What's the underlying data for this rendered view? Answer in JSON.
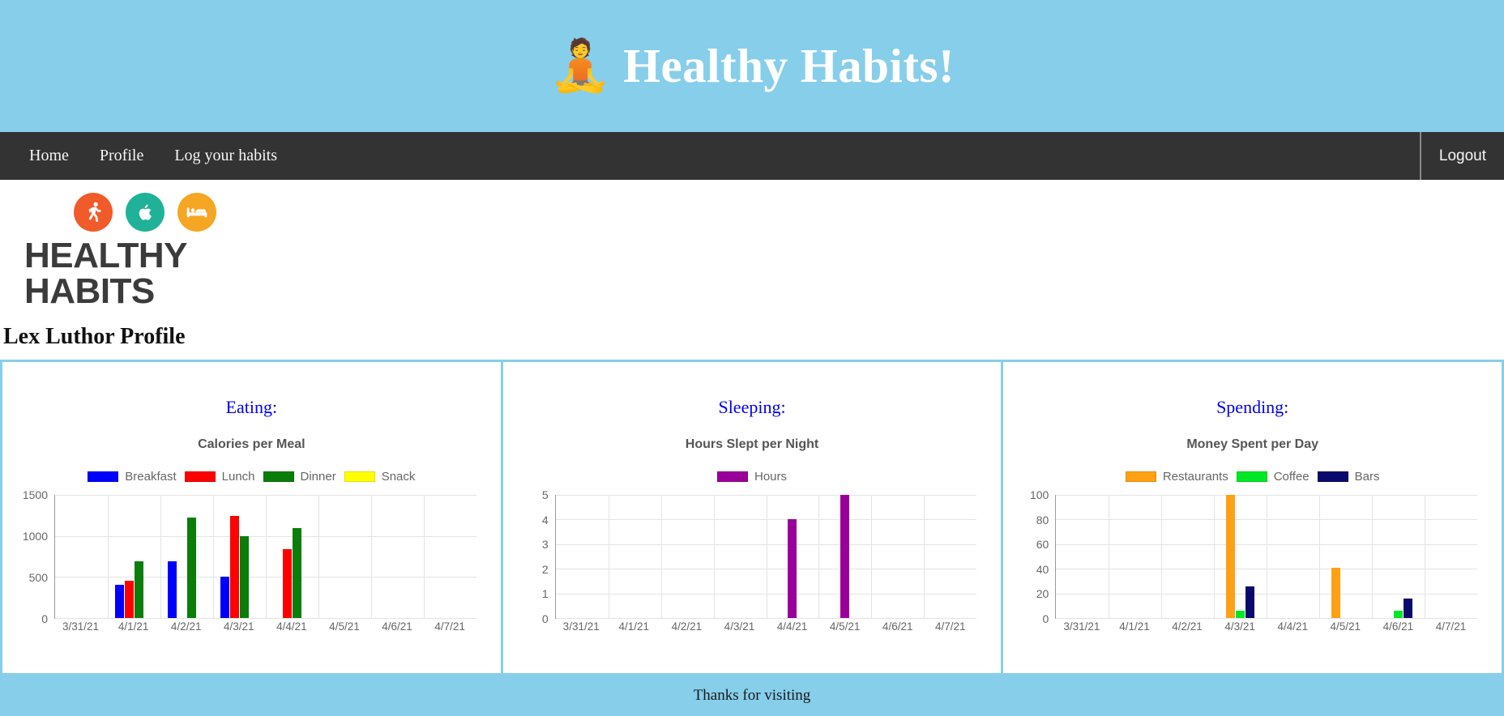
{
  "header": {
    "emoji_icon": "person-in-lotus-position-icon",
    "emoji": "🧘",
    "title": "Healthy Habits!",
    "background_color": "#87CEEB"
  },
  "navbar": {
    "background_color": "#333333",
    "links": [
      {
        "label": "Home"
      },
      {
        "label": "Profile"
      },
      {
        "label": "Log your habits"
      }
    ],
    "logout_label": "Logout"
  },
  "brand": {
    "word": "HEALTHY HABITS",
    "icons": [
      {
        "name": "running-person-icon",
        "color": "#F15A29"
      },
      {
        "name": "apple-icon",
        "color": "#1FB299"
      },
      {
        "name": "bed-icon",
        "color": "#F5A623"
      }
    ]
  },
  "page": {
    "profile_title": "Lex Luthor Profile",
    "card_border_color": "#87CEEB"
  },
  "cards": [
    {
      "heading": "Eating:"
    },
    {
      "heading": "Sleeping:"
    },
    {
      "heading": "Spending:"
    }
  ],
  "footer": {
    "text": "Thanks for visiting",
    "background_color": "#87CEEB"
  },
  "chart_data": [
    {
      "type": "bar",
      "title": "Calories per Meal",
      "xlabel": "",
      "ylabel": "",
      "categories": [
        "3/31/21",
        "4/1/21",
        "4/2/21",
        "4/3/21",
        "4/4/21",
        "4/5/21",
        "4/6/21",
        "4/7/21"
      ],
      "yticks": [
        0,
        500,
        1000,
        1500
      ],
      "ylim": [
        0,
        1500
      ],
      "grid": true,
      "legend_position": "top",
      "series": [
        {
          "name": "Breakfast",
          "color": "#0000FF",
          "values": [
            0,
            400,
            690,
            500,
            0,
            0,
            0,
            0
          ]
        },
        {
          "name": "Lunch",
          "color": "#FF0000",
          "values": [
            0,
            450,
            0,
            1240,
            840,
            0,
            0,
            0
          ]
        },
        {
          "name": "Dinner",
          "color": "#0A7D0A",
          "values": [
            0,
            690,
            1220,
            1000,
            1100,
            0,
            0,
            0
          ]
        },
        {
          "name": "Snack",
          "color": "#FFFF00",
          "values": [
            0,
            0,
            0,
            0,
            0,
            0,
            0,
            0
          ]
        }
      ]
    },
    {
      "type": "bar",
      "title": "Hours Slept per Night",
      "xlabel": "",
      "ylabel": "",
      "categories": [
        "3/31/21",
        "4/1/21",
        "4/2/21",
        "4/3/21",
        "4/4/21",
        "4/5/21",
        "4/6/21",
        "4/7/21"
      ],
      "yticks": [
        0,
        1,
        2,
        3,
        4,
        5
      ],
      "ylim": [
        0,
        5
      ],
      "grid": true,
      "legend_position": "top",
      "series": [
        {
          "name": "Hours",
          "color": "#990099",
          "values": [
            0,
            0,
            0,
            0,
            4,
            5,
            0,
            0
          ]
        }
      ]
    },
    {
      "type": "bar",
      "title": "Money Spent per Day",
      "xlabel": "",
      "ylabel": "",
      "categories": [
        "3/31/21",
        "4/1/21",
        "4/2/21",
        "4/3/21",
        "4/4/21",
        "4/5/21",
        "4/6/21",
        "4/7/21"
      ],
      "yticks": [
        0,
        20,
        40,
        60,
        80,
        100
      ],
      "ylim": [
        0,
        100
      ],
      "grid": true,
      "legend_position": "top",
      "series": [
        {
          "name": "Restaurants",
          "color": "#FFA015",
          "values": [
            0,
            0,
            0,
            100,
            0,
            41,
            0,
            0
          ]
        },
        {
          "name": "Coffee",
          "color": "#00E825",
          "values": [
            0,
            0,
            0,
            6,
            0,
            0,
            6,
            0
          ]
        },
        {
          "name": "Bars",
          "color": "#0A0A6E",
          "values": [
            0,
            0,
            0,
            25.5,
            0,
            0,
            16,
            0
          ]
        }
      ]
    }
  ]
}
